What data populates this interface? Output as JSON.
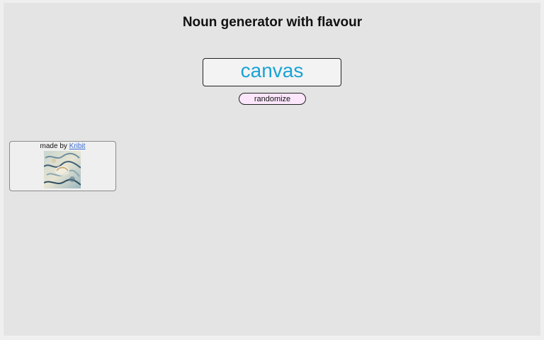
{
  "page": {
    "title": "Noun generator with flavour"
  },
  "generator": {
    "noun": "canvas",
    "randomize_label": "randomize",
    "accent_color": "#1aa3d6",
    "button_color": "#fbe6fb"
  },
  "credit": {
    "prefix": "made by ",
    "author": "Kribit",
    "avatar_icon": "author-avatar-image"
  }
}
